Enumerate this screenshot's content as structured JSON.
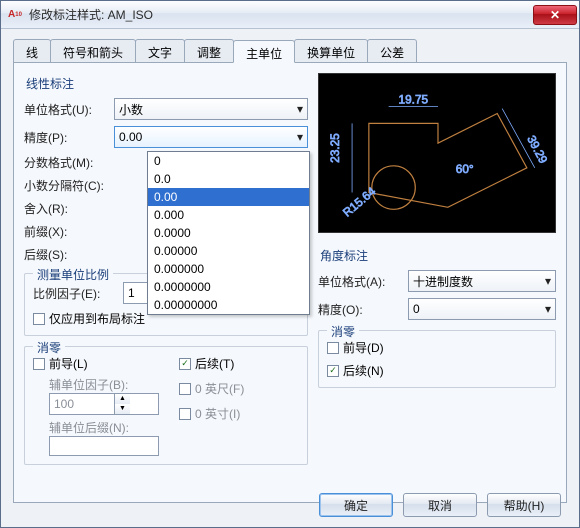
{
  "title": "修改标注样式: AM_ISO",
  "tabs": [
    "线",
    "符号和箭头",
    "文字",
    "调整",
    "主单位",
    "换算单位",
    "公差"
  ],
  "active_tab": 4,
  "linear": {
    "title": "线性标注",
    "unit_format_label": "单位格式(U):",
    "unit_format_value": "小数",
    "precision_label": "精度(P):",
    "precision_value": "0.00",
    "precision_options": [
      "0",
      "0.0",
      "0.00",
      "0.000",
      "0.0000",
      "0.00000",
      "0.000000",
      "0.0000000",
      "0.00000000"
    ],
    "fraction_label": "分数格式(M):",
    "decimal_sep_label": "小数分隔符(C):",
    "roundoff_label": "舍入(R):",
    "prefix_label": "前缀(X):",
    "suffix_label": "后缀(S):"
  },
  "scale": {
    "title": "测量单位比例",
    "factor_label": "比例因子(E):",
    "factor_value": "1",
    "layout_only_label": "仅应用到布局标注"
  },
  "zero": {
    "title": "消零",
    "leading_label": "前导(L)",
    "trailing_label": "后续(T)",
    "sub_factor_label": "辅单位因子(B):",
    "sub_factor_value": "100",
    "sub_suffix_label": "辅单位后缀(N):",
    "feet_label": "0 英尺(F)",
    "inches_label": "0 英寸(I)"
  },
  "angular": {
    "title": "角度标注",
    "unit_format_label": "单位格式(A):",
    "unit_format_value": "十进制度数",
    "precision_label": "精度(O):",
    "precision_value": "0",
    "zero_title": "消零",
    "leading_label": "前导(D)",
    "trailing_label": "后续(N)"
  },
  "preview": {
    "dim1": "19.75",
    "dim2": "23.25",
    "dim3": "39.29",
    "radius": "R15.64",
    "angle": "60°"
  },
  "buttons": {
    "ok": "确定",
    "cancel": "取消",
    "help": "帮助(H)"
  }
}
